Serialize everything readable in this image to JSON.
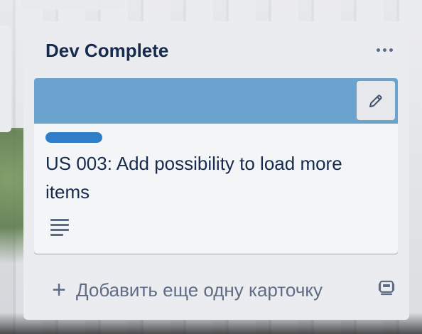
{
  "list": {
    "title": "Dev Complete",
    "menu_icon": "ellipsis-icon"
  },
  "card": {
    "cover_color": "#6ba3cf",
    "label_color": "#2f7ec7",
    "title": "US 003: Add possibility to load more items",
    "edit_icon": "pencil-icon",
    "badge_icon": "description-icon"
  },
  "composer": {
    "add_label": "Добавить еще одну карточку",
    "add_icon": "plus-icon",
    "template_icon": "card-template-icon"
  }
}
